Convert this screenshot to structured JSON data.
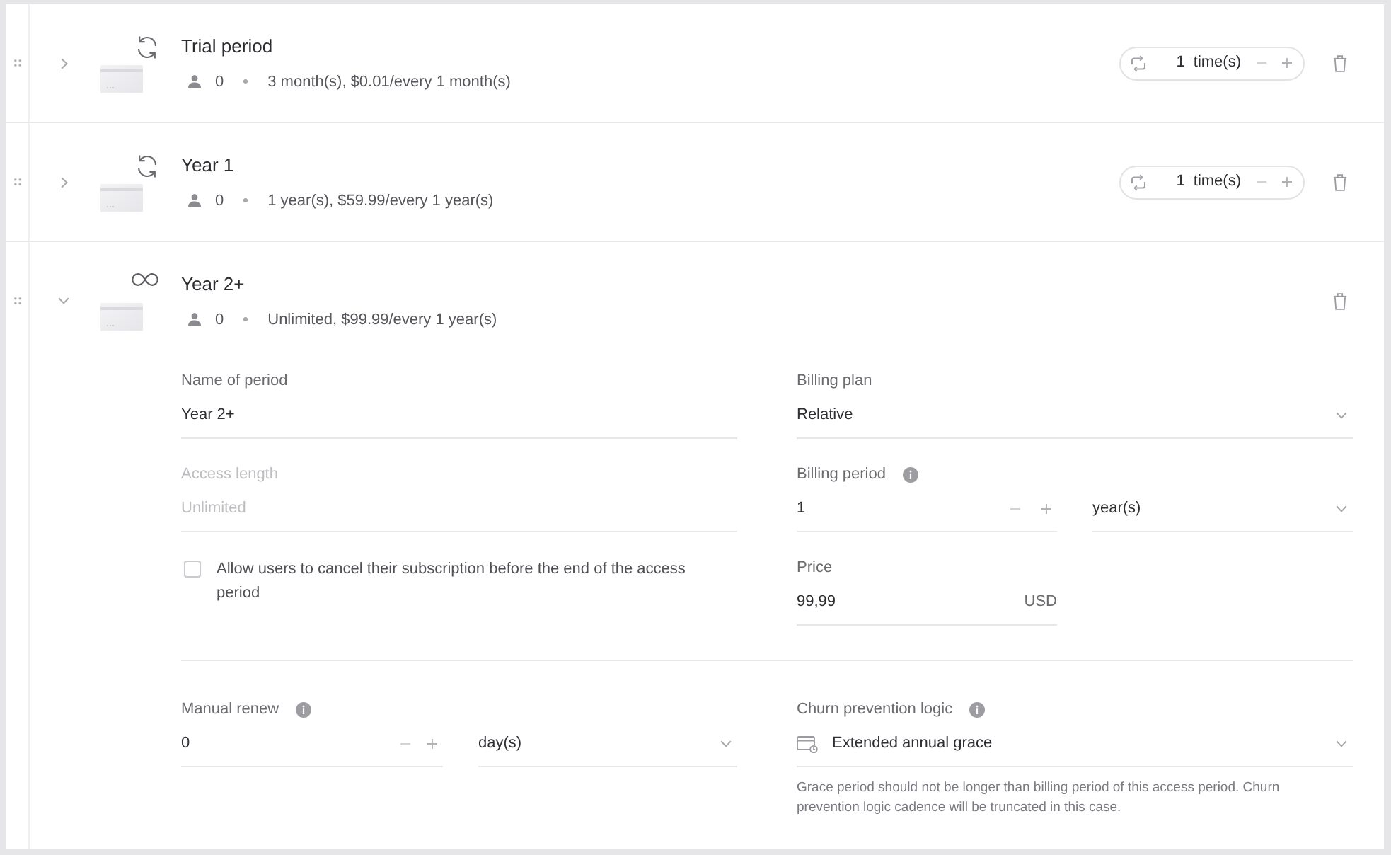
{
  "periods": [
    {
      "kind": "recurring",
      "title": "Trial period",
      "subscribers": "0",
      "summary": "3 month(s), $0.01/every 1 month(s)",
      "expanded": false,
      "repeat": {
        "count": "1",
        "unit": "time(s)"
      }
    },
    {
      "kind": "recurring",
      "title": "Year 1",
      "subscribers": "0",
      "summary": "1 year(s), $59.99/every 1 year(s)",
      "expanded": false,
      "repeat": {
        "count": "1",
        "unit": "time(s)"
      }
    },
    {
      "kind": "unlimited",
      "title": "Year 2+",
      "subscribers": "0",
      "summary": "Unlimited, $99.99/every 1 year(s)",
      "expanded": true,
      "details": {
        "name": {
          "label": "Name of period",
          "value": "Year 2+"
        },
        "billing_plan": {
          "label": "Billing plan",
          "value": "Relative"
        },
        "access_length": {
          "label": "Access length",
          "value": "Unlimited",
          "disabled": true
        },
        "billing_period": {
          "label": "Billing period",
          "value": "1",
          "unit": "year(s)"
        },
        "allow_cancel": {
          "label": "Allow users to cancel their subscription before the end of the access period",
          "checked": false
        },
        "price": {
          "label": "Price",
          "value": "99,99",
          "currency": "USD"
        },
        "manual_renew": {
          "label": "Manual renew",
          "value": "0",
          "unit": "day(s)"
        },
        "churn_prevention": {
          "label": "Churn prevention logic",
          "value": "Extended annual grace",
          "note": "Grace period should not be longer than billing period of this access period. Churn prevention logic cadence will be truncated in this case."
        }
      }
    }
  ]
}
